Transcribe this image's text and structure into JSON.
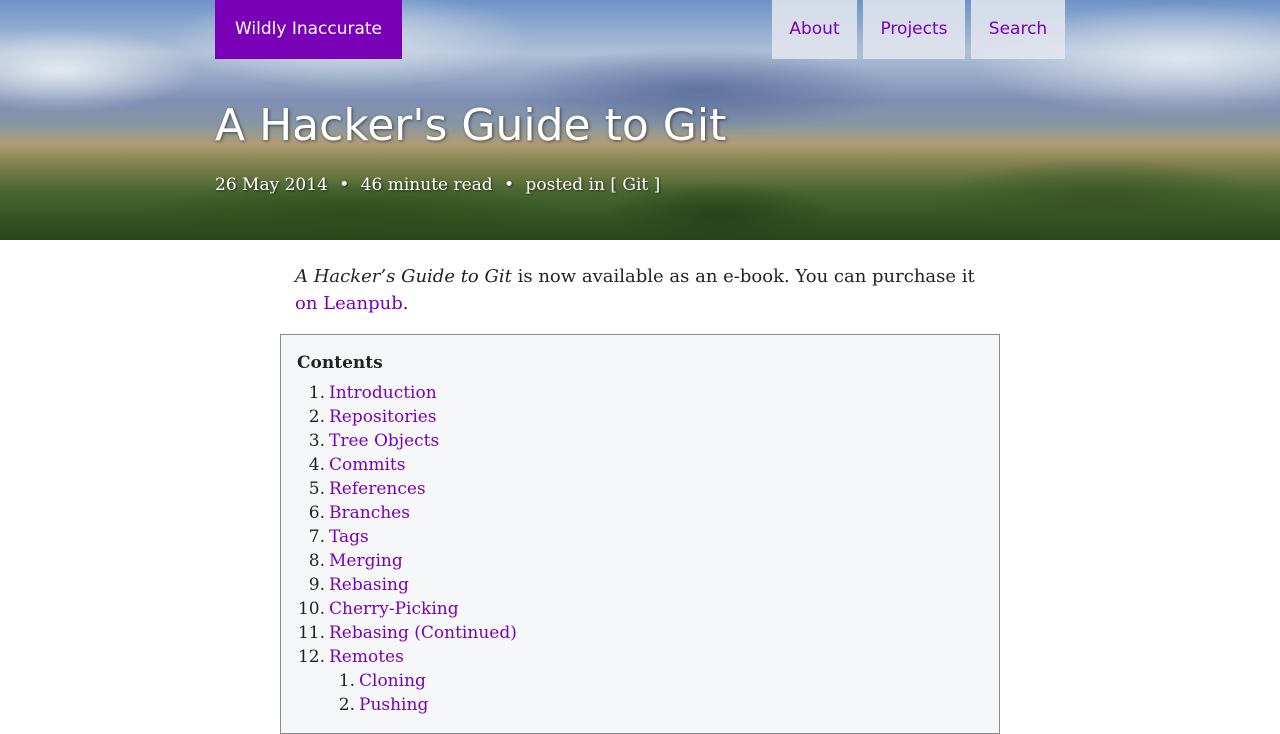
{
  "site": {
    "title": "Wildly Inaccurate",
    "nav": [
      {
        "label": "About"
      },
      {
        "label": "Projects"
      },
      {
        "label": "Search"
      }
    ],
    "accent_color": "#7a00b8"
  },
  "post": {
    "title": "A Hacker's Guide to Git",
    "date": "26 May 2014",
    "reading_time": "46 minute read",
    "posted_in_prefix": "posted in",
    "category": "Git",
    "bullet": "•"
  },
  "intro": {
    "book_title": "A Hacker’s Guide to Git",
    "text": " is now available as an e-book. You can purchase it ",
    "link_text": "on Leanpub",
    "end": "."
  },
  "toc": {
    "heading": "Contents",
    "items": [
      {
        "num": "1.",
        "label": "Introduction"
      },
      {
        "num": "2.",
        "label": "Repositories"
      },
      {
        "num": "3.",
        "label": "Tree Objects"
      },
      {
        "num": "4.",
        "label": "Commits"
      },
      {
        "num": "5.",
        "label": "References"
      },
      {
        "num": "6.",
        "label": "Branches"
      },
      {
        "num": "7.",
        "label": "Tags"
      },
      {
        "num": "8.",
        "label": "Merging"
      },
      {
        "num": "9.",
        "label": "Rebasing"
      },
      {
        "num": "10.",
        "label": "Cherry-Picking"
      },
      {
        "num": "11.",
        "label": "Rebasing (Continued)"
      },
      {
        "num": "12.",
        "label": "Remotes"
      }
    ],
    "sub_items": [
      {
        "num": "1.",
        "label": "Cloning"
      },
      {
        "num": "2.",
        "label": "Pushing"
      }
    ]
  }
}
